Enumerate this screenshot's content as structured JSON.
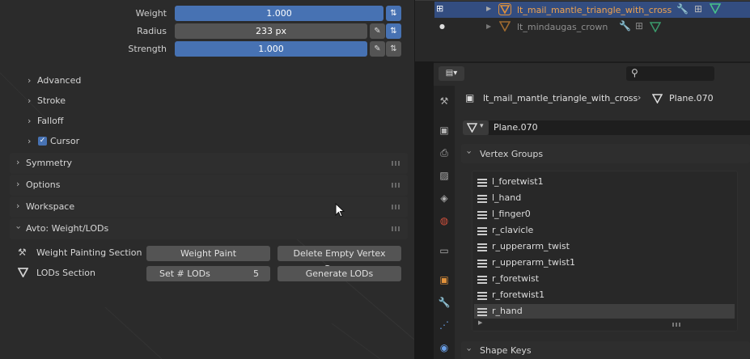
{
  "tool_settings": {
    "weight": {
      "label": "Weight",
      "value": "1.000"
    },
    "radius": {
      "label": "Radius",
      "value": "233 px"
    },
    "strength": {
      "label": "Strength",
      "value": "1.000"
    },
    "subpanels": [
      "Advanced",
      "Stroke",
      "Falloff",
      "Cursor"
    ],
    "panels": [
      "Symmetry",
      "Options",
      "Workspace",
      "Avto: Weight/LODs"
    ]
  },
  "avto": {
    "weight_section_label": "Weight Painting Section",
    "weight_paint_btn": "Weight Paint",
    "delete_groups_btn": "Delete Empty Vertex Groups",
    "lods_section_label": "LODs Section",
    "set_lods_label": "Set # LODs",
    "lods_value": "5",
    "generate_lods_btn": "Generate LODs"
  },
  "outliner": {
    "items": [
      {
        "name": "lt_mail_mantle_triangle_with_cross",
        "selected": true
      },
      {
        "name": "lt_mindaugas_crown",
        "selected": false
      }
    ]
  },
  "properties": {
    "breadcrumb_object": "lt_mail_mantle_triangle_with_cross",
    "breadcrumb_mesh": "Plane.070",
    "mesh_name": "Plane.070",
    "vertex_groups_title": "Vertex Groups",
    "shape_keys_title": "Shape Keys",
    "vertex_groups": [
      "l_foretwist1",
      "l_hand",
      "l_finger0",
      "r_clavicle",
      "r_upperarm_twist",
      "r_upperarm_twist1",
      "r_foretwist",
      "r_foretwist1",
      "r_hand"
    ]
  },
  "colors": {
    "accent": "#4772b3",
    "outliner_selected": "#334d80",
    "object_orange": "#e0913b",
    "mesh_green": "#48c48a"
  }
}
